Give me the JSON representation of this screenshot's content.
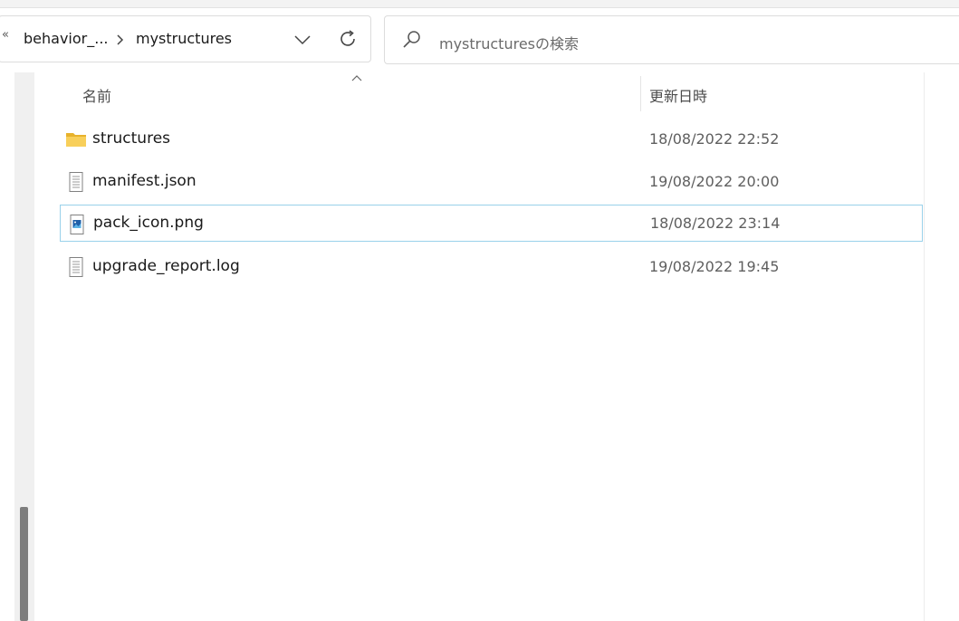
{
  "address": {
    "overflow_label": "«",
    "crumbs": [
      "behavior_...",
      "mystructures"
    ]
  },
  "search": {
    "placeholder": "mystructuresの検索"
  },
  "columns": {
    "name": "名前",
    "date_modified": "更新日時"
  },
  "files": [
    {
      "name": "structures",
      "date": "18/08/2022 22:52",
      "icon": "folder-icon"
    },
    {
      "name": "manifest.json",
      "date": "19/08/2022 20:00",
      "icon": "document-icon"
    },
    {
      "name": "pack_icon.png",
      "date": "18/08/2022 23:14",
      "icon": "image-file-icon"
    },
    {
      "name": "upgrade_report.log",
      "date": "19/08/2022 19:45",
      "icon": "document-icon"
    }
  ],
  "colors": {
    "selection_border": "#99d1ea",
    "folder": "#f5c542"
  }
}
